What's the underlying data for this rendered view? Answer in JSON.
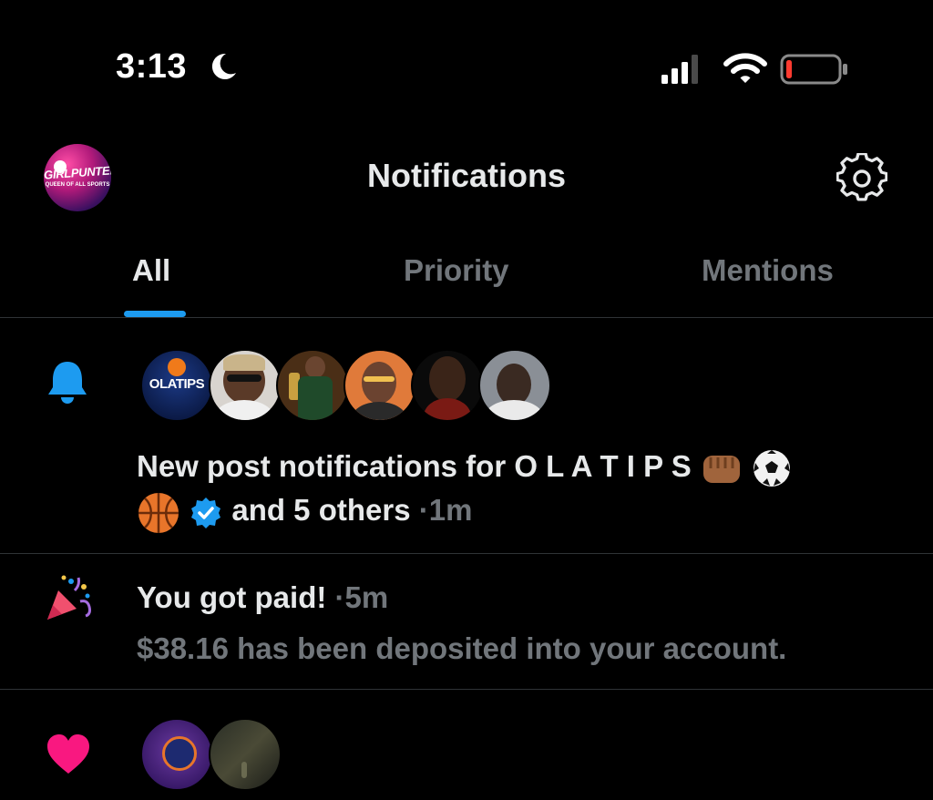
{
  "status_bar": {
    "time": "3:13"
  },
  "header": {
    "title": "Notifications",
    "avatar_brand": "GIRLPUNTER",
    "avatar_sub": "QUEEN OF ALL SPORTS"
  },
  "tabs": [
    {
      "label": "All",
      "selected": true
    },
    {
      "label": "Priority",
      "selected": false
    },
    {
      "label": "Mentions",
      "selected": false
    }
  ],
  "notifications": [
    {
      "type": "new-post",
      "avatar_label": "OLATIPS",
      "text_prefix": "New post notifications for O L A T I P S",
      "text_suffix": "and 5 others",
      "separator": "·",
      "time": "1m"
    },
    {
      "type": "payment",
      "title": "You got paid!",
      "separator": "·",
      "time": "5m",
      "body": "$38.16 has been deposited into your account."
    },
    {
      "type": "like"
    }
  ],
  "colors": {
    "accent": "#1d9bf0",
    "heart": "#f91880",
    "muted": "#71767b",
    "text": "#e7e9ea"
  }
}
